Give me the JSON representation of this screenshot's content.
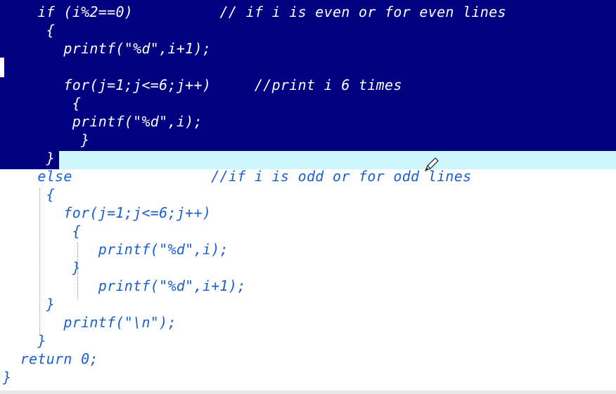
{
  "editor": {
    "lines": [
      {
        "indent": "    ",
        "code": "if (i%2==0)          ",
        "comment": "// if i is even or for even lines",
        "selected": true
      },
      {
        "indent": "     ",
        "code": "{",
        "comment": "",
        "selected": true
      },
      {
        "indent": "       ",
        "code": "printf(\"%d\",i+1);",
        "comment": "",
        "selected": true
      },
      {
        "indent": "",
        "code": "",
        "comment": "",
        "selected": true
      },
      {
        "indent": "       ",
        "code": "for(j=1;j<=6;j++)     ",
        "comment": "//print i 6 times",
        "selected": true
      },
      {
        "indent": "        ",
        "code": "{",
        "comment": "",
        "selected": true
      },
      {
        "indent": "        ",
        "code": "printf(\"%d\",i);",
        "comment": "",
        "selected": true
      },
      {
        "indent": "        ",
        "code": " }",
        "comment": "",
        "selected": true
      },
      {
        "indent": "     ",
        "code": "}",
        "comment": "",
        "selected": true
      },
      {
        "indent": "    ",
        "code": "else                ",
        "comment": "//if i is odd or for odd lines",
        "selected": false
      },
      {
        "indent": "     ",
        "code": "{",
        "comment": "",
        "selected": false
      },
      {
        "indent": "       ",
        "code": "for(j=1;j<=6;j++)",
        "comment": "",
        "selected": false
      },
      {
        "indent": "        ",
        "code": "{",
        "comment": "",
        "selected": false
      },
      {
        "indent": "           ",
        "code": "printf(\"%d\",i);",
        "comment": "",
        "selected": false
      },
      {
        "indent": "        ",
        "code": "}",
        "comment": "",
        "selected": false
      },
      {
        "indent": "           ",
        "code": "printf(\"%d\",i+1);",
        "comment": "",
        "selected": false
      },
      {
        "indent": "     ",
        "code": "}",
        "comment": "",
        "selected": false
      },
      {
        "indent": "       ",
        "code": "printf(\"\\n\");",
        "comment": "",
        "selected": false
      },
      {
        "indent": "    ",
        "code": "}",
        "comment": "",
        "selected": false
      },
      {
        "indent": "  ",
        "code": "return 0;",
        "comment": "",
        "selected": false
      },
      {
        "indent": "",
        "code": "}",
        "comment": "",
        "selected": false
      }
    ]
  },
  "colors": {
    "selection_bg": "#000080",
    "current_line_bg": "#cdf7fb",
    "code_text": "#1a5fd0",
    "selected_text": "#ffffff"
  },
  "icons": {
    "cursor": "pencil-cursor-icon"
  }
}
